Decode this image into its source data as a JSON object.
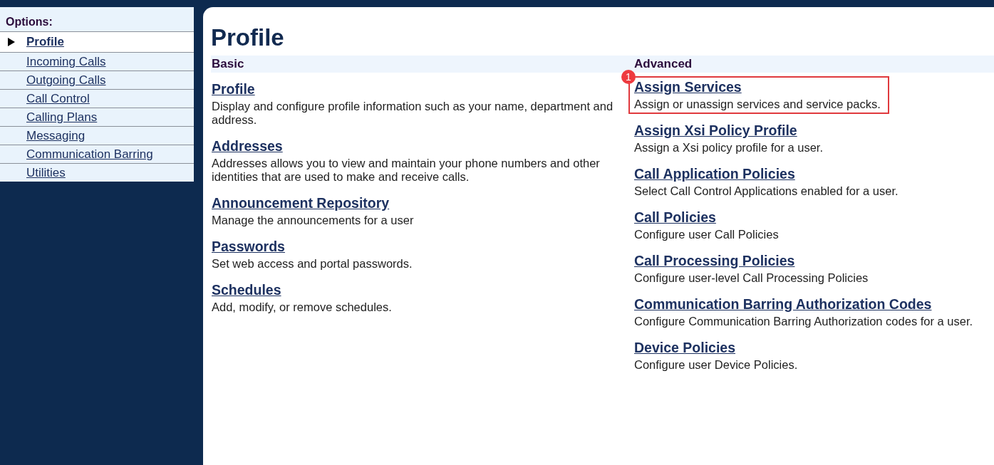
{
  "sidebar": {
    "title": "Options:",
    "items": [
      {
        "label": "Profile",
        "selected": true
      },
      {
        "label": "Incoming Calls",
        "selected": false
      },
      {
        "label": "Outgoing Calls",
        "selected": false
      },
      {
        "label": "Call Control",
        "selected": false
      },
      {
        "label": "Calling Plans",
        "selected": false
      },
      {
        "label": "Messaging",
        "selected": false
      },
      {
        "label": "Communication Barring",
        "selected": false
      },
      {
        "label": "Utilities",
        "selected": false
      }
    ]
  },
  "page_title": "Profile",
  "sections": [
    {
      "heading": "Basic",
      "items": [
        {
          "title": "Profile",
          "description": "Display and configure profile information such as your name, department and address.",
          "highlighted": false
        },
        {
          "title": "Addresses",
          "description": "Addresses allows you to view and maintain your phone numbers and other identities that are used to make and receive calls.",
          "highlighted": false
        },
        {
          "title": "Announcement Repository",
          "description": "Manage the announcements for a user",
          "highlighted": false
        },
        {
          "title": "Passwords",
          "description": "Set web access and portal passwords.",
          "highlighted": false
        },
        {
          "title": "Schedules",
          "description": "Add, modify, or remove schedules.",
          "highlighted": false
        }
      ]
    },
    {
      "heading": "Advanced",
      "items": [
        {
          "title": "Assign Services",
          "description": "Assign or unassign services and service packs.",
          "highlighted": true,
          "badge": "1"
        },
        {
          "title": "Assign Xsi Policy Profile",
          "description": "Assign a Xsi policy profile for a user.",
          "highlighted": false
        },
        {
          "title": "Call Application Policies",
          "description": "Select Call Control Applications enabled for a user.",
          "highlighted": false
        },
        {
          "title": "Call Policies",
          "description": "Configure user Call Policies",
          "highlighted": false
        },
        {
          "title": "Call Processing Policies",
          "description": "Configure user-level Call Processing Policies",
          "highlighted": false
        },
        {
          "title": "Communication Barring Authorization Codes",
          "description": "Configure Communication Barring Authorization codes for a user.",
          "highlighted": false
        },
        {
          "title": "Device Policies",
          "description": "Configure user Device Policies.",
          "highlighted": false
        }
      ]
    }
  ]
}
